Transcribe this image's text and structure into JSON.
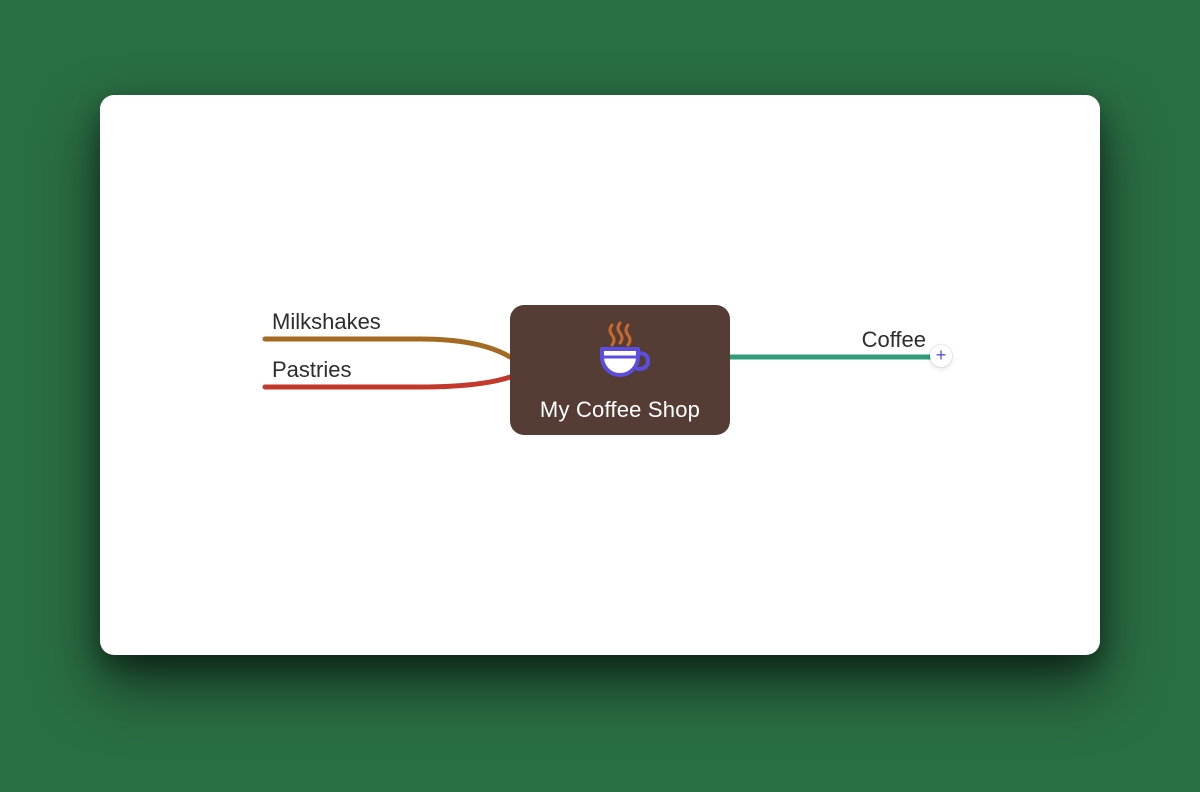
{
  "center": {
    "title": "My Coffee Shop",
    "icon": "coffee-cup-icon",
    "bg": "#553d35"
  },
  "branches": {
    "left": [
      {
        "label": "Milkshakes",
        "color": "#a56a21"
      },
      {
        "label": "Pastries",
        "color": "#c2392b"
      }
    ],
    "right": [
      {
        "label": "Coffee",
        "color": "#2f9d7c"
      }
    ]
  },
  "add_button": {
    "symbol": "+",
    "color": "#5a4de0"
  }
}
